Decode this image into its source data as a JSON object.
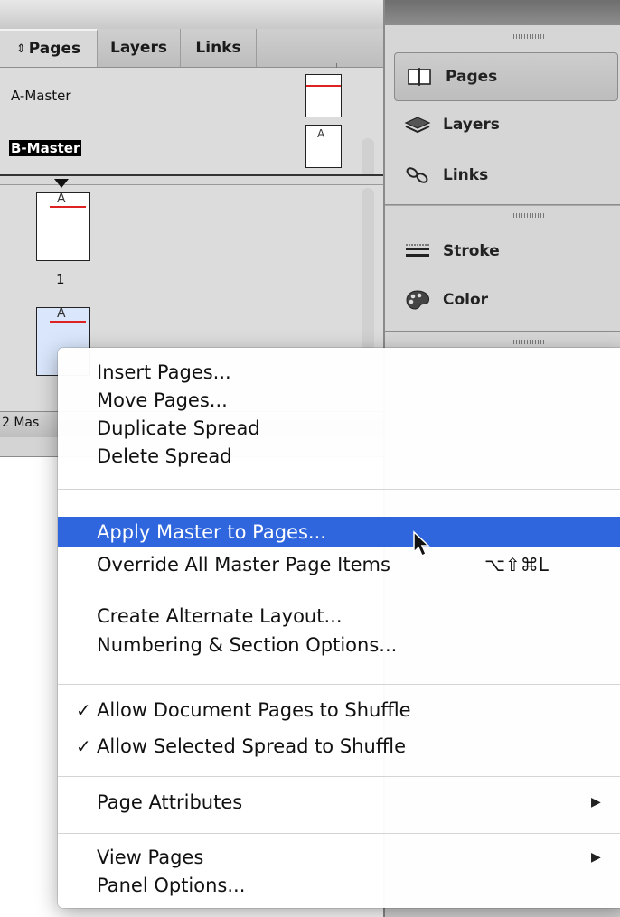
{
  "pages_panel": {
    "tabs": [
      {
        "label": "Pages",
        "sort_icon": "⇕"
      },
      {
        "label": "Layers"
      },
      {
        "label": "Links"
      }
    ],
    "fast_forward_glyph": "▸▸",
    "panel_menu_glyph": "▾≡",
    "masters": [
      {
        "label": "A-Master",
        "thumb_letter": ""
      },
      {
        "label": "B-Master",
        "thumb_letter": "A"
      }
    ],
    "document_pages": [
      {
        "number": "1",
        "thumb_letter": "A"
      },
      {
        "number": "",
        "thumb_letter": "A"
      }
    ],
    "status_text": "2 Mas"
  },
  "dock": {
    "items": [
      {
        "label": "Pages",
        "icon": "pages-icon"
      },
      {
        "label": "Layers",
        "icon": "layers-icon"
      },
      {
        "label": "Links",
        "icon": "links-icon"
      },
      {
        "label": "Stroke",
        "icon": "stroke-icon"
      },
      {
        "label": "Color",
        "icon": "color-palette-icon"
      }
    ]
  },
  "context_menu": {
    "groups": [
      [
        {
          "label": "Insert Pages..."
        },
        {
          "label": "Move Pages..."
        },
        {
          "label": "Duplicate Spread"
        },
        {
          "label": "Delete Spread"
        }
      ],
      [
        {
          "label": "Apply Master to Pages...",
          "highlighted": true
        },
        {
          "label": "Override All Master Page Items",
          "shortcut": "⌥⇧⌘L"
        }
      ],
      [
        {
          "label": "Create Alternate Layout..."
        },
        {
          "label": "Numbering & Section Options..."
        }
      ],
      [
        {
          "label": "Allow Document Pages to Shuffle",
          "checked": true
        },
        {
          "label": "Allow Selected Spread to Shuffle",
          "checked": true
        }
      ],
      [
        {
          "label": "Page Attributes",
          "submenu": true
        }
      ],
      [
        {
          "label": "View Pages",
          "submenu": true
        },
        {
          "label": "Panel Options..."
        }
      ]
    ],
    "check_glyph": "✓",
    "submenu_glyph": "▶"
  },
  "colors": {
    "highlight": "#2f66dd",
    "master_line": "#dd2222",
    "selected_page_fill": "#d9e6fb"
  }
}
